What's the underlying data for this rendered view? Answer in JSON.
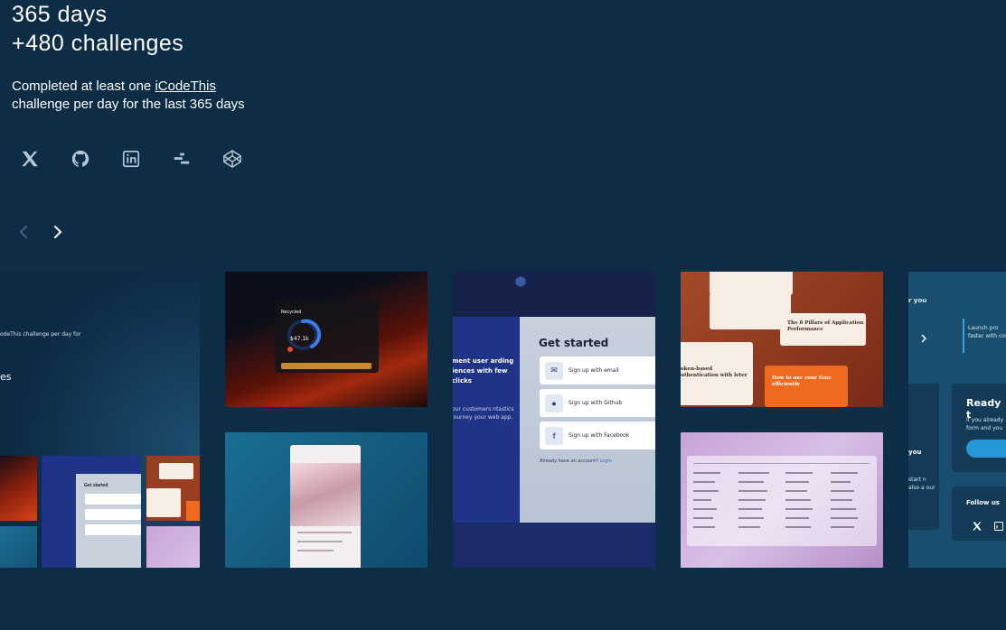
{
  "headline": {
    "days": "365 days",
    "challenges": "+480 challenges"
  },
  "description": {
    "before": "Completed at least one ",
    "link": "iCodeThis",
    "after": "challenge per day for the last 365 days"
  },
  "socials": [
    "x-icon",
    "github-icon",
    "linkedin-icon",
    "dailydev-icon",
    "codepen-icon"
  ],
  "carousel": {
    "prev_enabled": false,
    "next_enabled": true
  },
  "cards": {
    "c1": {
      "line1": "odeThis challenge per day for",
      "line2": "es"
    },
    "c2": {
      "label": "Recycled",
      "value": "$47.1k"
    },
    "c4": {
      "title": "Get started",
      "left_heading": "ment user arding iences with few clicks",
      "left_sub": "our customers ntastics journey your web app.",
      "btn_email": "Sign up with email",
      "btn_github": "Sign up with Github",
      "btn_facebook": "Sign up with Facebook",
      "already": "Already have an account?",
      "login": "Login"
    },
    "c5": {
      "note1": "The 8 Pillars of Application Performance",
      "note2": "How to use your time efficiently",
      "note3": "oken-based uthentication with leter"
    },
    "c7": {
      "ready": "Ready t",
      "follow": "Follow us",
      "side1": "r you",
      "side2": "Launch pro faster with code",
      "side3": "If you already form and you",
      "side4": "you",
      "side5": "start n also a our"
    }
  },
  "colors": {
    "background": "#0c2d45",
    "accent": "#2596d8"
  }
}
